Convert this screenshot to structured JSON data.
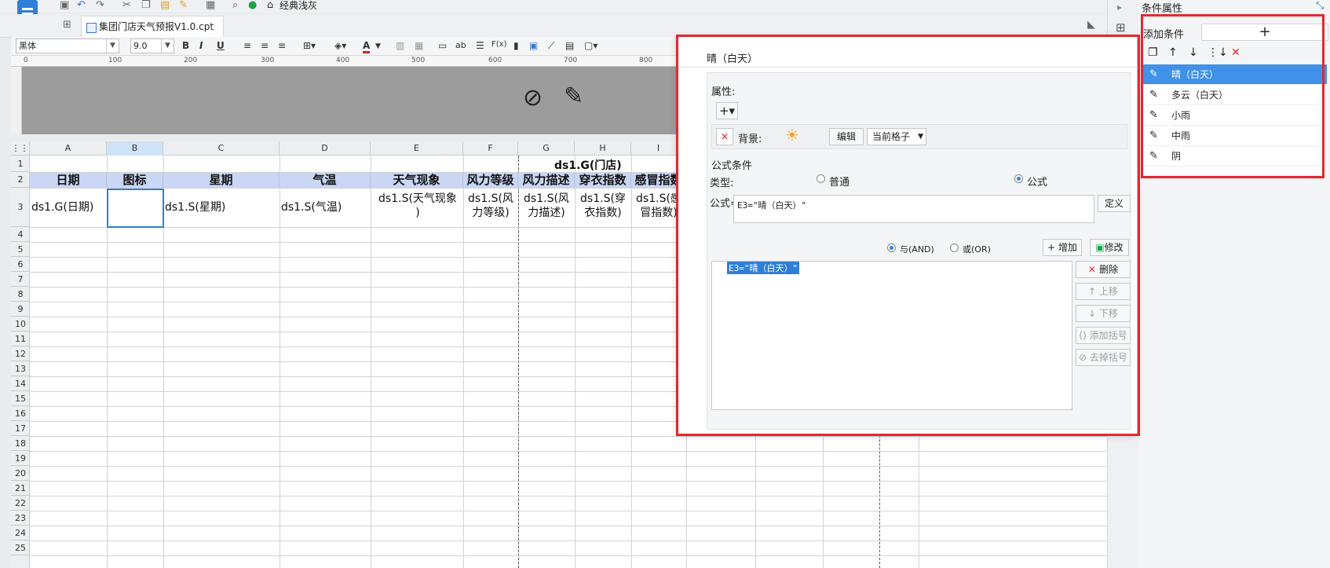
{
  "file_tab": "集团门店天气预报V1.0.cpt",
  "toolbar": {
    "theme_label": "经典浅灰"
  },
  "format": {
    "font": "黑体",
    "size": "9.0"
  },
  "ruler_ticks": [
    "0",
    "100",
    "200",
    "300",
    "400",
    "500",
    "600",
    "700",
    "800"
  ],
  "columns": [
    "A",
    "B",
    "C",
    "D",
    "E",
    "F",
    "G",
    "H",
    "I"
  ],
  "rows": [
    "1",
    "2",
    "3",
    "4",
    "5",
    "6",
    "7",
    "8",
    "9",
    "10",
    "11",
    "12",
    "13",
    "14",
    "15",
    "16",
    "17",
    "18",
    "19",
    "20",
    "21",
    "22",
    "23",
    "24",
    "25"
  ],
  "sheet": {
    "title_cell": "ds1.G(门店)",
    "headers": [
      "日期",
      "图标",
      "星期",
      "气温",
      "天气现象",
      "风力等级",
      "风力描述",
      "穿衣指数",
      "感冒指数"
    ],
    "data_row": [
      "ds1.G(日期)",
      "",
      "ds1.S(星期)",
      "ds1.S(气温)",
      "ds1.S(天气现象\n)",
      "ds1.S(风\n力等级)",
      "ds1.S(风\n力描述)",
      "ds1.S(穿\n衣指数)",
      "ds1.S(感\n冒指数)"
    ]
  },
  "dialog": {
    "title": "晴（白天）",
    "attr_label": "属性:",
    "bg_label": "背景:",
    "edit_btn": "编辑",
    "scope_value": "当前格子",
    "formula_section": "公式条件",
    "type_label": "类型:",
    "type_normal": "普通",
    "type_formula": "公式",
    "formula_label": "公式=",
    "formula_value": "E3=\"晴（白天）\"",
    "define_btn": "定义",
    "and_label": "与(AND)",
    "or_label": "或(OR)",
    "add_btn": "增加",
    "modify_btn": "修改",
    "condition_item": "E3=\"晴（白天）\"",
    "delete_btn": "删除",
    "up_btn": "上移",
    "down_btn": "下移",
    "add_paren_btn": "添加括号",
    "remove_paren_btn": "去掉括号"
  },
  "panel": {
    "title": "条件属性",
    "add_label": "添加条件",
    "add_btn": "+",
    "conditions": [
      "晴（白天）",
      "多云（白天）",
      "小雨",
      "中雨",
      "阴"
    ]
  },
  "colors": {
    "accent": "#3f92e8",
    "highlight_box": "#e3282e",
    "header_fill": "#c9d6f4"
  }
}
